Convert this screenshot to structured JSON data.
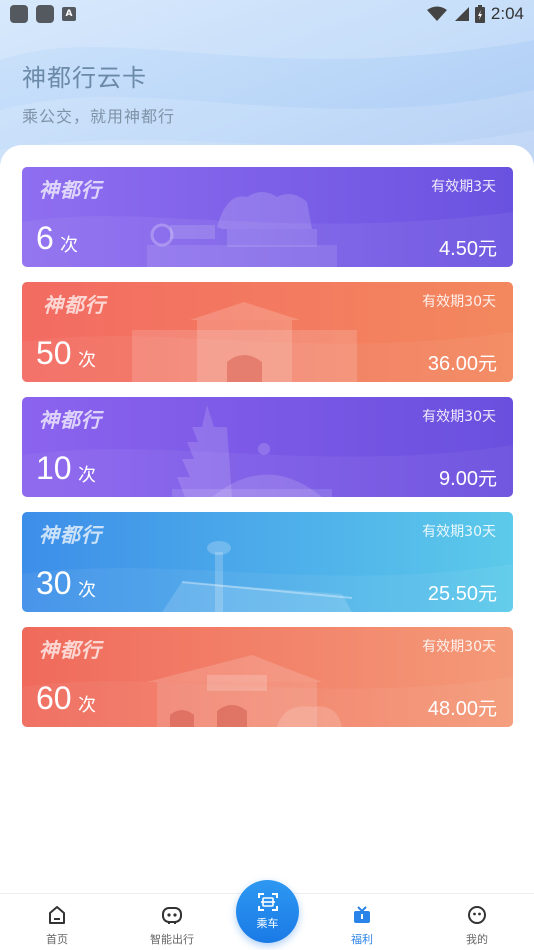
{
  "status_bar": {
    "time": "2:04",
    "notification_icons": [
      "app-icon",
      "app-icon",
      "a-icon"
    ],
    "a_icon_glyph": "A"
  },
  "header": {
    "title": "神都行云卡",
    "subtitle": "乘公交，就用神都行"
  },
  "cards": [
    {
      "brand": "神都行",
      "validity": "有效期3天",
      "count": "6",
      "unit": "次",
      "price": "4.50",
      "currency": "元",
      "gradient": [
        "#8f6ef0",
        "#6a52e0"
      ],
      "landmark": "chariot-statue"
    },
    {
      "brand": "神都行",
      "validity": "有效期30天",
      "count": "50",
      "unit": "次",
      "price": "36.00",
      "currency": "元",
      "gradient": [
        "#f36b62",
        "#f3885e"
      ],
      "landmark": "city-gate"
    },
    {
      "brand": "神都行",
      "validity": "有效期30天",
      "count": "10",
      "unit": "次",
      "price": "9.00",
      "currency": "元",
      "gradient": [
        "#8b63ee",
        "#6a4fde"
      ],
      "landmark": "pagoda-and-dome"
    },
    {
      "brand": "神都行",
      "validity": "有效期30天",
      "count": "30",
      "unit": "次",
      "price": "25.50",
      "currency": "元",
      "gradient": [
        "#3d8ee9",
        "#5ccaea"
      ],
      "landmark": "airport-tower"
    },
    {
      "brand": "神都行",
      "validity": "有效期30天",
      "count": "60",
      "unit": "次",
      "price": "48.00",
      "currency": "元",
      "gradient": [
        "#f06a5c",
        "#f49a78"
      ],
      "landmark": "temple-gate"
    }
  ],
  "bottom_nav": {
    "items": [
      {
        "label": "首页",
        "icon": "home-icon",
        "active": false
      },
      {
        "label": "智能出行",
        "icon": "robot-icon",
        "active": false
      },
      {
        "label": "福利",
        "icon": "gift-icon",
        "active": true
      },
      {
        "label": "我的",
        "icon": "smile-icon",
        "active": false
      }
    ],
    "center_button": {
      "label": "乘车",
      "icon": "scan-icon"
    }
  },
  "colors": {
    "accent": "#2a83e8",
    "title": "#6b89a8"
  }
}
